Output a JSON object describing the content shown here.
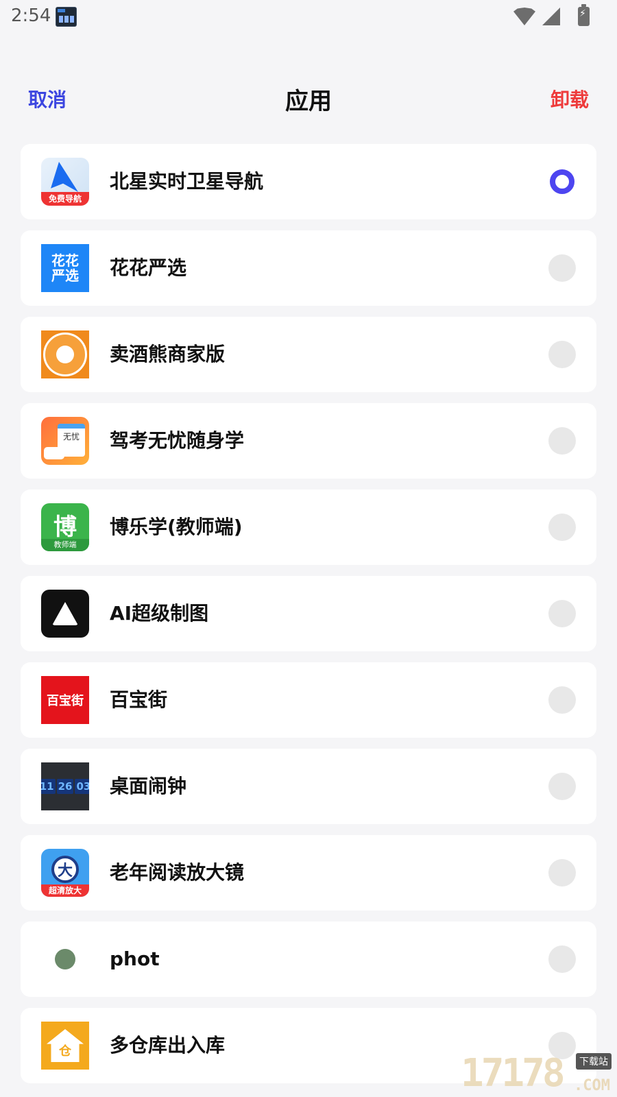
{
  "status_bar": {
    "time": "2:54"
  },
  "header": {
    "cancel_label": "取消",
    "title": "应用",
    "uninstall_label": "卸载"
  },
  "apps": [
    {
      "name": "北星实时卫星导航",
      "icon": "navigation-arrow-icon",
      "icon_text": "免费导航",
      "selected": true
    },
    {
      "name": "花花严选",
      "icon": "huahua-icon",
      "icon_text": "花花严选",
      "selected": false
    },
    {
      "name": "卖酒熊商家版",
      "icon": "bear-icon",
      "selected": false
    },
    {
      "name": "驾考无忧随身学",
      "icon": "driving-calendar-icon",
      "icon_text": "无忧",
      "selected": false
    },
    {
      "name": "博乐学(教师端)",
      "icon": "bo-graduation-icon",
      "icon_text": "教师端",
      "selected": false
    },
    {
      "name": "AI超级制图",
      "icon": "ai-triangle-icon",
      "selected": false
    },
    {
      "name": "百宝街",
      "icon": "baibaojie-icon",
      "icon_text": "百宝街",
      "selected": false
    },
    {
      "name": "桌面闹钟",
      "icon": "flip-clock-icon",
      "icon_text": [
        "11",
        "26",
        "03"
      ],
      "selected": false
    },
    {
      "name": "老年阅读放大镜",
      "icon": "magnifier-icon",
      "icon_text": "大",
      "icon_tag": "超清放大",
      "selected": false
    },
    {
      "name": "phot",
      "icon": "dot-icon",
      "selected": false
    },
    {
      "name": "多仓库出入库",
      "icon": "warehouse-house-icon",
      "icon_text": "仓",
      "selected": false
    }
  ],
  "watermark": {
    "number": "17178",
    "tag": "下载站",
    "suffix": ".COM"
  },
  "colors": {
    "accent_blue": "#3c46e0",
    "danger_red": "#ee3b3b",
    "radio_selected": "#4d45f0",
    "background": "#f5f5f7"
  }
}
